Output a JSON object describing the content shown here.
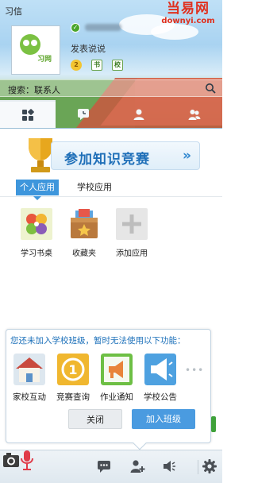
{
  "window": {
    "title": "习信"
  },
  "watermark": {
    "main": "当易网",
    "sub": "downyi.com"
  },
  "profile": {
    "logo_text": "习网",
    "signature": "发表说说",
    "badges": [
      "2",
      "书",
      "校"
    ]
  },
  "search": {
    "placeholder": "搜索：联系人"
  },
  "main_tabs": [
    "apps",
    "recent",
    "contact",
    "group"
  ],
  "promo": {
    "text": "参加知识竞赛",
    "arrow": "»"
  },
  "sub_tabs": [
    "个人应用",
    "学校应用"
  ],
  "apps": [
    {
      "label": "学习书桌",
      "icon": "clover-icon"
    },
    {
      "label": "收藏夹",
      "icon": "favorites-box-icon"
    },
    {
      "label": "添加应用",
      "icon": "add-icon"
    }
  ],
  "popup": {
    "message": "您还未加入学校班级，暂时无法使用以下功能：",
    "features": [
      {
        "label": "家校互动",
        "icon": "home-icon",
        "color": "#c94a3e"
      },
      {
        "label": "竞赛查询",
        "icon": "medal-icon",
        "color": "#f0b72f"
      },
      {
        "label": "作业通知",
        "icon": "megaphone-icon",
        "color": "#6dbf44"
      },
      {
        "label": "学校公告",
        "icon": "loudspeaker-icon",
        "color": "#4ea1e0"
      }
    ],
    "more": "•••",
    "close_label": "关闭",
    "join_label": "加入班级"
  },
  "toolbar": [
    "camera-mic-icon",
    "chat-icon",
    "add-contact-icon",
    "volume-icon",
    "settings-icon"
  ],
  "colors": {
    "accent": "#3e96dc",
    "link": "#1a6fb9",
    "join_button": "#4a9be0"
  }
}
